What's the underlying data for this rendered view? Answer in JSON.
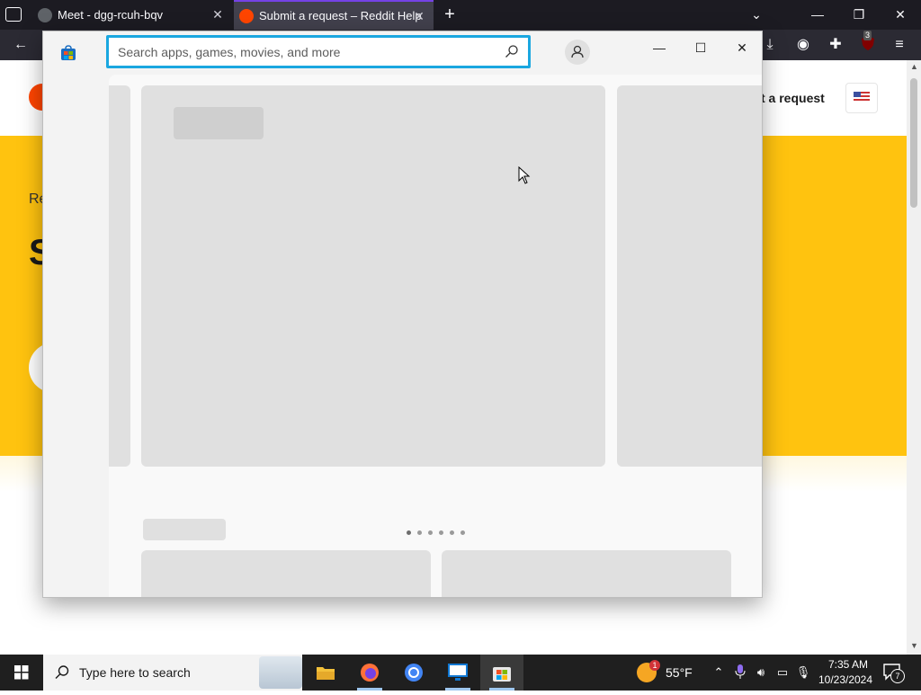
{
  "browser": {
    "tabs": [
      {
        "title": "Meet - dgg-rcuh-bqv",
        "active": false
      },
      {
        "title": "Submit a request – Reddit Help",
        "active": true
      }
    ],
    "toolbar": {
      "extension_badge": "3"
    }
  },
  "page_behind": {
    "submit_link": "t a request",
    "breadcrumb_fragment": "Re",
    "title_fragment": "S",
    "colors": {
      "banner": "#ffc30f",
      "reddit_orange": "#ff4500"
    }
  },
  "store": {
    "search": {
      "placeholder": "Search apps, games, movies, and more"
    },
    "carousel": {
      "page_count": 6,
      "current_page": 1
    }
  },
  "taskbar": {
    "search_placeholder": "Type here to search",
    "weather": {
      "temp": "55°F",
      "badge": "1"
    },
    "clock": {
      "time": "7:35 AM",
      "date": "10/23/2024"
    },
    "notification_count": "7"
  }
}
